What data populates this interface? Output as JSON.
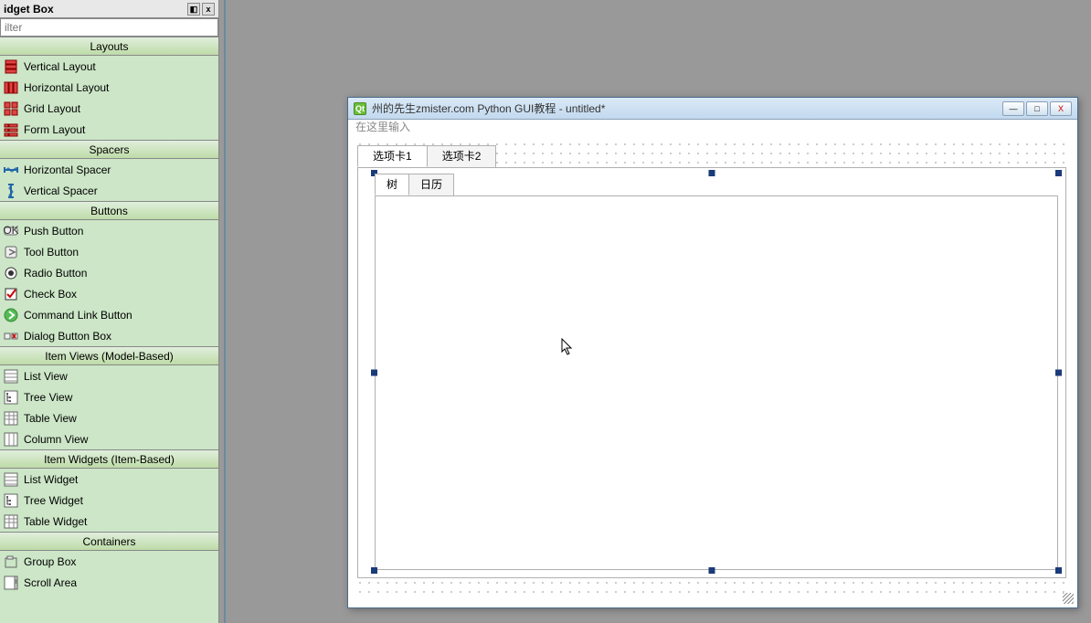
{
  "widget_box": {
    "title": "idget Box",
    "dock_btn": "◧",
    "close_btn": "x",
    "filter_placeholder": "ilter",
    "sections": [
      {
        "name": "layouts",
        "header": "Layouts",
        "items": [
          {
            "name": "vertical-layout",
            "label": "Vertical Layout",
            "icon": "vlayout"
          },
          {
            "name": "horizontal-layout",
            "label": "Horizontal Layout",
            "icon": "hlayout"
          },
          {
            "name": "grid-layout",
            "label": "Grid Layout",
            "icon": "grid"
          },
          {
            "name": "form-layout",
            "label": "Form Layout",
            "icon": "form"
          }
        ]
      },
      {
        "name": "spacers",
        "header": "Spacers",
        "items": [
          {
            "name": "horizontal-spacer",
            "label": "Horizontal Spacer",
            "icon": "hspacer"
          },
          {
            "name": "vertical-spacer",
            "label": "Vertical Spacer",
            "icon": "vspacer"
          }
        ]
      },
      {
        "name": "buttons",
        "header": "Buttons",
        "items": [
          {
            "name": "push-button",
            "label": "Push Button",
            "icon": "push"
          },
          {
            "name": "tool-button",
            "label": "Tool Button",
            "icon": "tool"
          },
          {
            "name": "radio-button",
            "label": "Radio Button",
            "icon": "radio"
          },
          {
            "name": "check-box",
            "label": "Check Box",
            "icon": "check"
          },
          {
            "name": "command-link-button",
            "label": "Command Link Button",
            "icon": "cmdlink"
          },
          {
            "name": "dialog-button-box",
            "label": "Dialog Button Box",
            "icon": "dlgbox"
          }
        ]
      },
      {
        "name": "item-views",
        "header": "Item Views (Model-Based)",
        "items": [
          {
            "name": "list-view",
            "label": "List View",
            "icon": "listview"
          },
          {
            "name": "tree-view",
            "label": "Tree View",
            "icon": "treeview"
          },
          {
            "name": "table-view",
            "label": "Table View",
            "icon": "tableview"
          },
          {
            "name": "column-view",
            "label": "Column View",
            "icon": "columnview"
          }
        ]
      },
      {
        "name": "item-widgets",
        "header": "Item Widgets (Item-Based)",
        "items": [
          {
            "name": "list-widget",
            "label": "List Widget",
            "icon": "listview"
          },
          {
            "name": "tree-widget",
            "label": "Tree Widget",
            "icon": "treeview"
          },
          {
            "name": "table-widget",
            "label": "Table Widget",
            "icon": "tableview"
          }
        ]
      },
      {
        "name": "containers",
        "header": "Containers",
        "items": [
          {
            "name": "group-box",
            "label": "Group Box",
            "icon": "groupbox"
          },
          {
            "name": "scroll-area",
            "label": "Scroll Area",
            "icon": "scrollarea"
          }
        ]
      }
    ]
  },
  "form_window": {
    "title": "州的先生zmister.com Python GUI教程 - untitled*",
    "menubar_hint": "在这里输入",
    "min_btn": "—",
    "max_btn": "□",
    "close_btn": "X",
    "outer_tabs": [
      {
        "name": "tab1",
        "label": "选项卡1",
        "active": true
      },
      {
        "name": "tab2",
        "label": "选项卡2",
        "active": false
      }
    ],
    "inner_tabs": [
      {
        "name": "tree-tab",
        "label": "树",
        "active": true
      },
      {
        "name": "calendar-tab",
        "label": "日历",
        "active": false
      }
    ]
  }
}
